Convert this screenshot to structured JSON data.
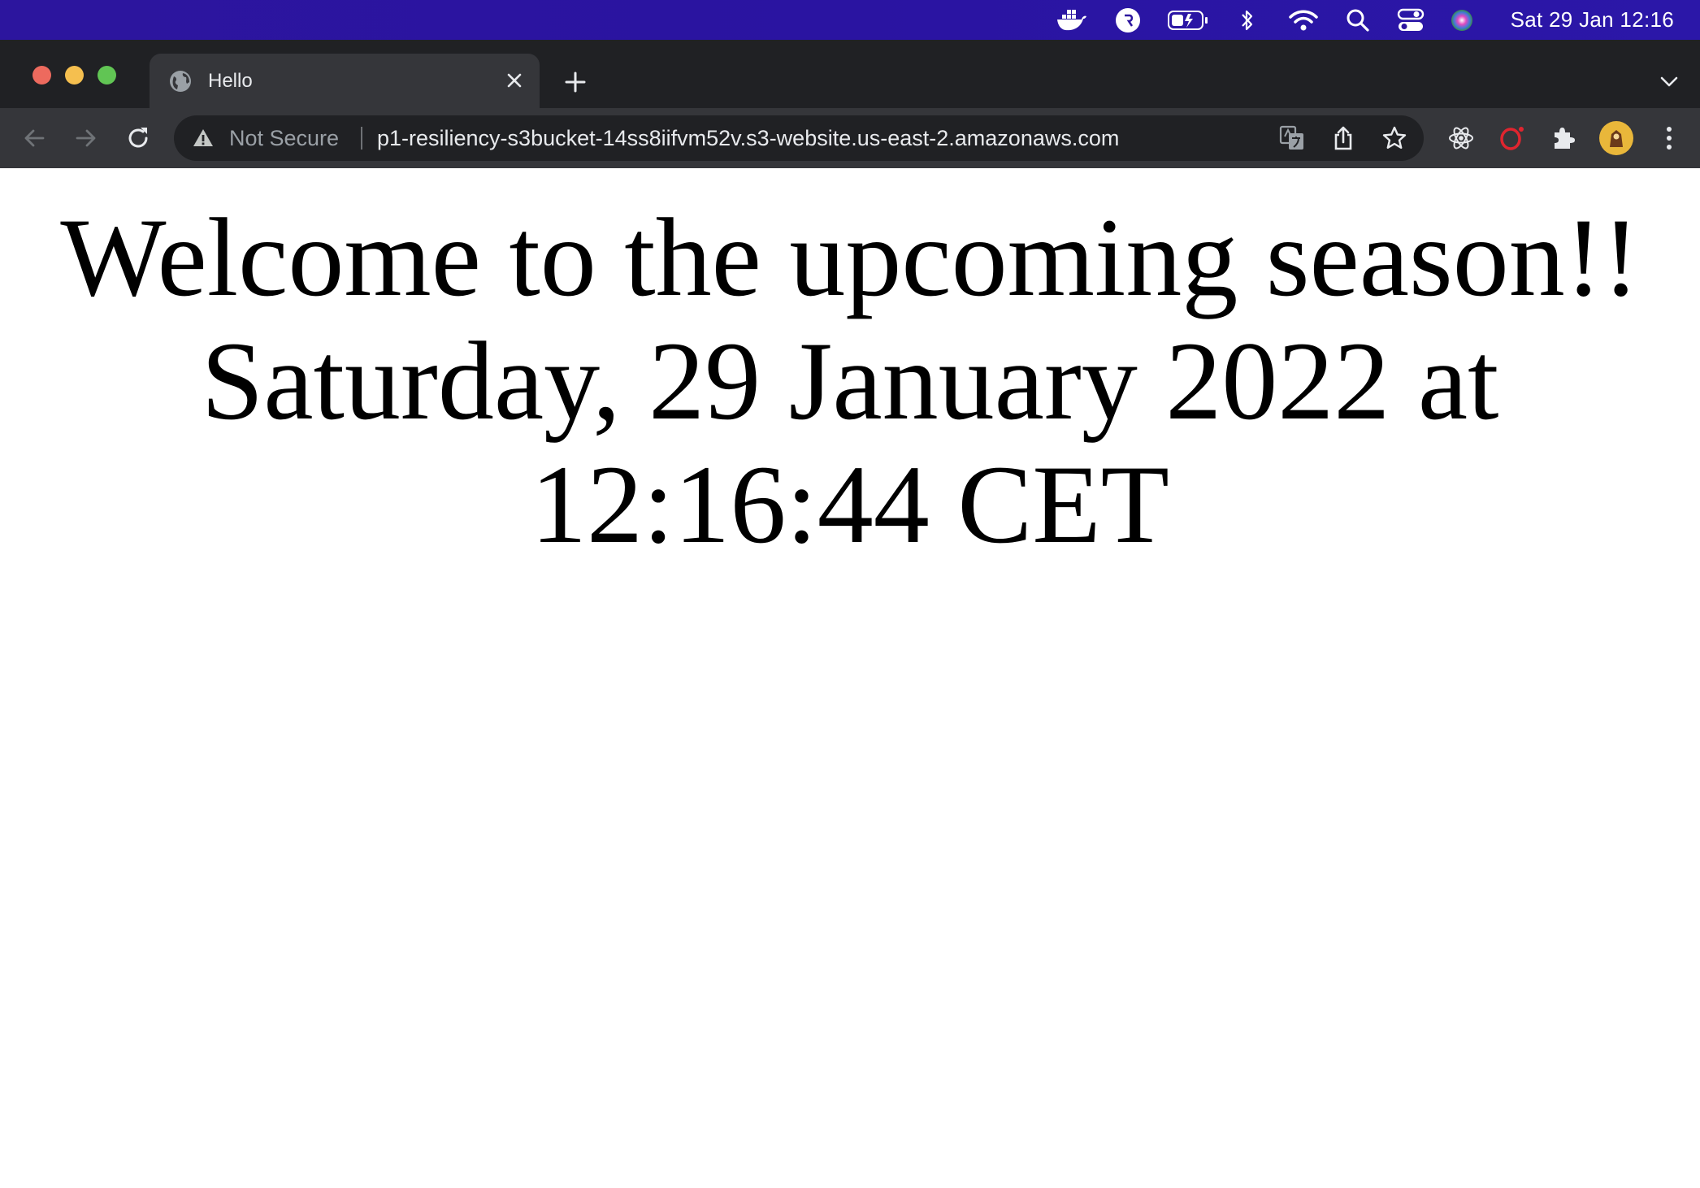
{
  "menubar": {
    "icons": [
      "docker-icon",
      "r-app-icon",
      "battery-charging-icon",
      "bluetooth-icon",
      "wifi-icon",
      "search-icon",
      "control-center-icon",
      "siri-icon"
    ],
    "clock": "Sat 29 Jan  12:16",
    "background_color": "#2c159e"
  },
  "browser": {
    "tab": {
      "title": "Hello"
    },
    "address_bar": {
      "security_label": "Not Secure",
      "url": "p1-resiliency-s3bucket-14ss8iifvm52v.s3-website.us-east-2.amazonaws.com"
    },
    "toolbar_icons": [
      "translate-icon",
      "share-icon",
      "bookmark-star-icon",
      "react-devtools-icon",
      "opera-icon",
      "extensions-icon",
      "profile-avatar",
      "more-menu-icon"
    ]
  },
  "page": {
    "heading": "Welcome to the upcoming season!!",
    "datetime": "Saturday, 29 January 2022 at 12:16:44 CET"
  },
  "colors": {
    "traffic_close": "#ed6a5e",
    "traffic_min": "#f5bf4f",
    "traffic_max": "#61c554",
    "tab_strip": "#202124",
    "toolbar": "#35363a",
    "opera_red": "#e0252f"
  }
}
